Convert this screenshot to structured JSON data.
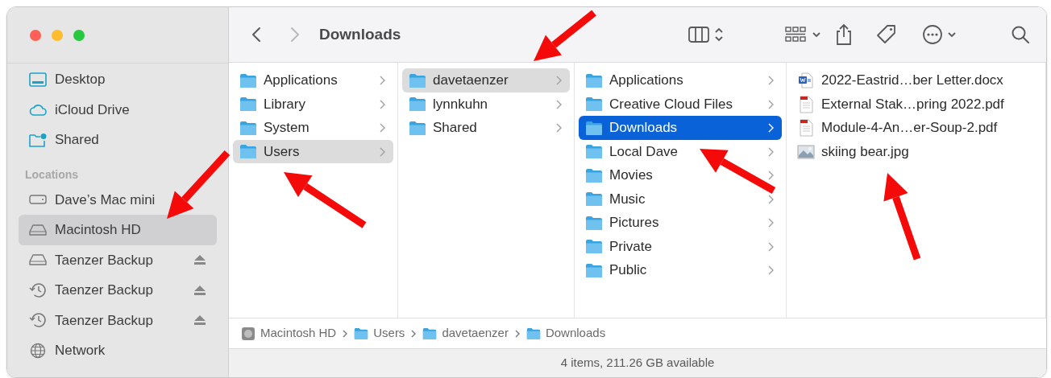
{
  "window": {
    "title": "Downloads"
  },
  "toolbar": {
    "back": {
      "disabled": false
    },
    "forward": {
      "disabled": true
    }
  },
  "sidebar": {
    "items": [
      {
        "label": "Desktop",
        "kind": "desktop",
        "selected": false,
        "eject": false
      },
      {
        "label": "iCloud Drive",
        "kind": "cloud",
        "selected": false,
        "eject": false
      },
      {
        "label": "Shared",
        "kind": "shared",
        "selected": false,
        "eject": false
      }
    ],
    "sections": [
      {
        "title": "Locations",
        "items": [
          {
            "label": "Dave’s Mac mini",
            "kind": "computer",
            "selected": false,
            "eject": false
          },
          {
            "label": "Macintosh HD",
            "kind": "disk",
            "selected": true,
            "eject": false
          },
          {
            "label": "Taenzer Backup",
            "kind": "disk",
            "selected": false,
            "eject": true
          },
          {
            "label": "Taenzer Backup",
            "kind": "backup",
            "selected": false,
            "eject": true
          },
          {
            "label": "Taenzer Backup",
            "kind": "backup",
            "selected": false,
            "eject": true
          },
          {
            "label": "Network",
            "kind": "network",
            "selected": false,
            "eject": false
          }
        ]
      }
    ]
  },
  "columns": [
    {
      "items": [
        {
          "label": "Applications",
          "kind": "folder",
          "selected": false
        },
        {
          "label": "Library",
          "kind": "folder",
          "selected": false
        },
        {
          "label": "System",
          "kind": "folder",
          "selected": false
        },
        {
          "label": "Users",
          "kind": "folder",
          "selected": true
        }
      ]
    },
    {
      "items": [
        {
          "label": "davetaenzer",
          "kind": "folder",
          "selected": true
        },
        {
          "label": "lynnkuhn",
          "kind": "folder",
          "selected": false
        },
        {
          "label": "Shared",
          "kind": "folder",
          "selected": false
        }
      ]
    },
    {
      "items": [
        {
          "label": "Applications",
          "kind": "folder",
          "selected": false
        },
        {
          "label": "Creative Cloud Files",
          "kind": "folder",
          "selected": false
        },
        {
          "label": "Downloads",
          "kind": "folder",
          "selected": true
        },
        {
          "label": "Local Dave",
          "kind": "folder",
          "selected": false
        },
        {
          "label": "Movies",
          "kind": "folder",
          "selected": false
        },
        {
          "label": "Music",
          "kind": "folder",
          "selected": false
        },
        {
          "label": "Pictures",
          "kind": "folder",
          "selected": false
        },
        {
          "label": "Private",
          "kind": "folder",
          "selected": false
        },
        {
          "label": "Public",
          "kind": "folder",
          "selected": false
        }
      ]
    },
    {
      "items": [
        {
          "label": "2022-Eastrid…ber Letter.docx",
          "kind": "docx",
          "selected": false
        },
        {
          "label": "External Stak…pring 2022.pdf",
          "kind": "pdf",
          "selected": false
        },
        {
          "label": "Module-4-An…er-Soup-2.pdf",
          "kind": "pdf",
          "selected": false
        },
        {
          "label": "skiing bear.jpg",
          "kind": "image",
          "selected": false
        }
      ]
    }
  ],
  "path_bar": [
    {
      "label": "Macintosh HD",
      "kind": "disk"
    },
    {
      "label": "Users",
      "kind": "folder"
    },
    {
      "label": "davetaenzer",
      "kind": "folder"
    },
    {
      "label": "Downloads",
      "kind": "folder"
    }
  ],
  "status_bar": "4 items, 211.26 GB available"
}
